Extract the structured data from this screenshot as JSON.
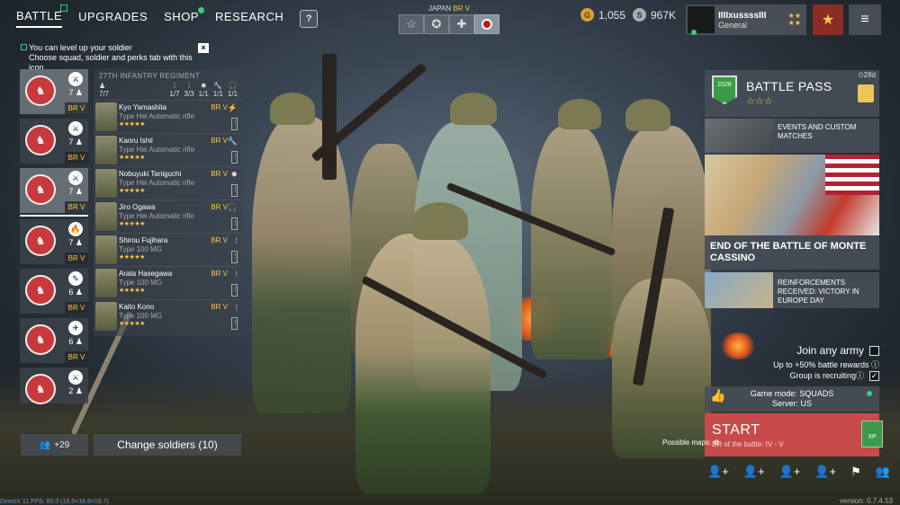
{
  "nav": {
    "tabs": [
      {
        "label": "BATTLE"
      },
      {
        "label": "UPGRADES"
      },
      {
        "label": "SHOP"
      },
      {
        "label": "RESEARCH"
      }
    ],
    "help_label": "?"
  },
  "mode_selector": {
    "nation": "JAPAN",
    "br": "BR V",
    "modes": [
      "star-icon",
      "circle-star-icon",
      "cross-icon",
      "rising-sun-icon"
    ]
  },
  "currency": {
    "gold": "1,055",
    "silver": "967K"
  },
  "profile": {
    "name": "IIIIxussssIII",
    "rank": "General",
    "stars": "★★\n★★"
  },
  "menu_icon": "≡",
  "notice": {
    "line1": "You can level up your soldier",
    "line2": "Choose squad, soldier and perks tab with this icon",
    "close": "×"
  },
  "squads": [
    {
      "badge": "♞",
      "count": "7",
      "br": "BR V",
      "icon": "⚔",
      "num": "⊕"
    },
    {
      "badge": "♞",
      "count": "7",
      "br": "BR V",
      "icon": "⚔",
      "num": "2Ω"
    },
    {
      "badge": "♞",
      "count": "7",
      "br": "BR V",
      "icon": "⚔",
      "num": "⊕"
    },
    {
      "badge": "♞",
      "count": "7",
      "br": "BR V",
      "icon": "🔥",
      "num": "⊕"
    },
    {
      "badge": "♞",
      "count": "6",
      "br": "BR V",
      "icon": "✎",
      "num": "⊕"
    },
    {
      "badge": "♞",
      "count": "6",
      "br": "BR V",
      "icon": "✈",
      "num": "⊕"
    },
    {
      "badge": "♞",
      "count": "2",
      "br": "BR V",
      "icon": "⚔",
      "num": "⊕"
    }
  ],
  "panel": {
    "regiment": "27TH INFANTRY REGIMENT",
    "count": "7/7",
    "slots": [
      "1/7",
      "3/3",
      "1/1",
      "1/1",
      "1/1"
    ],
    "soldiers": [
      {
        "name": "Kyo Yamashita",
        "weapon": "Type Hei Automatic rifle",
        "br": "BR V",
        "kit": "⚡",
        "stars": "★★★★★"
      },
      {
        "name": "Kaoru Ishii",
        "weapon": "Type Hei Automatic rifle",
        "br": "BR V",
        "kit": "🔧",
        "stars": "★★★★★"
      },
      {
        "name": "Nobuyuki Taniguchi",
        "weapon": "Type Hei Automatic rifle",
        "br": "BR V",
        "kit": "✹",
        "stars": "★★★★★"
      },
      {
        "name": "Jiro Ogawa",
        "weapon": "Type Hei Automatic rifle",
        "br": "BR V",
        "kit": "🎧",
        "stars": "★★★★★"
      },
      {
        "name": "Shirou Fujihara",
        "weapon": "Type 100 MG",
        "br": "BR V",
        "kit": "⁞",
        "stars": "★★★★★"
      },
      {
        "name": "Arata Hasegawa",
        "weapon": "Type 100 MG",
        "br": "BR V",
        "kit": "⁞",
        "stars": "★★★★★"
      },
      {
        "name": "Kaito Kono",
        "weapon": "Type 100 MG",
        "br": "BR V",
        "kit": "⁞",
        "stars": "★★★★★"
      }
    ]
  },
  "bottom_left": {
    "plus_label": "+29",
    "change_label": "Change soldiers (10)"
  },
  "battle_pass": {
    "title": "BATTLE PASS",
    "stars": "☆☆☆",
    "days": "⏲28d",
    "emblem": "2026"
  },
  "events": [
    {
      "title": "EVENTS AND CUSTOM MATCHES"
    },
    {
      "title": "END OF THE BATTLE OF MONTE CASSINO"
    },
    {
      "title": "REINFORCEMENTS RECEIVED: VICTORY IN EUROPE DAY"
    }
  ],
  "join": {
    "title": "Join any army",
    "sub": "Up to +50% battle rewards",
    "recruit": "Group is recruiting"
  },
  "game_mode": {
    "line1": "Game mode: SQUADS",
    "line2": "Server: US"
  },
  "start": {
    "label": "START",
    "br": "BR of the battle: IV - V",
    "xp": "XP"
  },
  "possible_maps": "Possible maps:",
  "debug": "DirectX 11 FPS: 60.0 (16.5<16.8<16.7)",
  "version": "version: 0.7.4.53"
}
